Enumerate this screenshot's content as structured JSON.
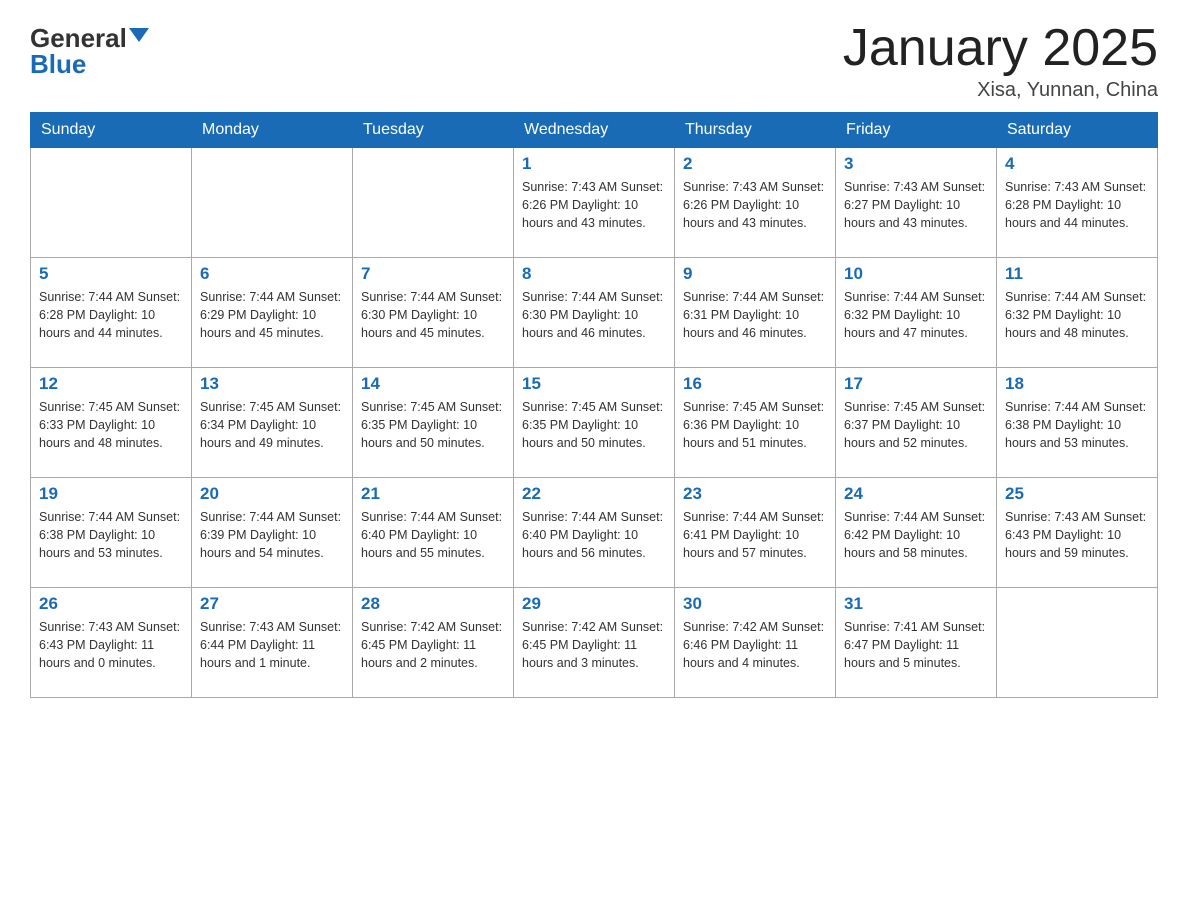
{
  "header": {
    "logo_text_black": "General",
    "logo_text_blue": "Blue",
    "month_title": "January 2025",
    "location": "Xisa, Yunnan, China"
  },
  "days_of_week": [
    "Sunday",
    "Monday",
    "Tuesday",
    "Wednesday",
    "Thursday",
    "Friday",
    "Saturday"
  ],
  "weeks": [
    [
      {
        "day": "",
        "info": ""
      },
      {
        "day": "",
        "info": ""
      },
      {
        "day": "",
        "info": ""
      },
      {
        "day": "1",
        "info": "Sunrise: 7:43 AM\nSunset: 6:26 PM\nDaylight: 10 hours\nand 43 minutes."
      },
      {
        "day": "2",
        "info": "Sunrise: 7:43 AM\nSunset: 6:26 PM\nDaylight: 10 hours\nand 43 minutes."
      },
      {
        "day": "3",
        "info": "Sunrise: 7:43 AM\nSunset: 6:27 PM\nDaylight: 10 hours\nand 43 minutes."
      },
      {
        "day": "4",
        "info": "Sunrise: 7:43 AM\nSunset: 6:28 PM\nDaylight: 10 hours\nand 44 minutes."
      }
    ],
    [
      {
        "day": "5",
        "info": "Sunrise: 7:44 AM\nSunset: 6:28 PM\nDaylight: 10 hours\nand 44 minutes."
      },
      {
        "day": "6",
        "info": "Sunrise: 7:44 AM\nSunset: 6:29 PM\nDaylight: 10 hours\nand 45 minutes."
      },
      {
        "day": "7",
        "info": "Sunrise: 7:44 AM\nSunset: 6:30 PM\nDaylight: 10 hours\nand 45 minutes."
      },
      {
        "day": "8",
        "info": "Sunrise: 7:44 AM\nSunset: 6:30 PM\nDaylight: 10 hours\nand 46 minutes."
      },
      {
        "day": "9",
        "info": "Sunrise: 7:44 AM\nSunset: 6:31 PM\nDaylight: 10 hours\nand 46 minutes."
      },
      {
        "day": "10",
        "info": "Sunrise: 7:44 AM\nSunset: 6:32 PM\nDaylight: 10 hours\nand 47 minutes."
      },
      {
        "day": "11",
        "info": "Sunrise: 7:44 AM\nSunset: 6:32 PM\nDaylight: 10 hours\nand 48 minutes."
      }
    ],
    [
      {
        "day": "12",
        "info": "Sunrise: 7:45 AM\nSunset: 6:33 PM\nDaylight: 10 hours\nand 48 minutes."
      },
      {
        "day": "13",
        "info": "Sunrise: 7:45 AM\nSunset: 6:34 PM\nDaylight: 10 hours\nand 49 minutes."
      },
      {
        "day": "14",
        "info": "Sunrise: 7:45 AM\nSunset: 6:35 PM\nDaylight: 10 hours\nand 50 minutes."
      },
      {
        "day": "15",
        "info": "Sunrise: 7:45 AM\nSunset: 6:35 PM\nDaylight: 10 hours\nand 50 minutes."
      },
      {
        "day": "16",
        "info": "Sunrise: 7:45 AM\nSunset: 6:36 PM\nDaylight: 10 hours\nand 51 minutes."
      },
      {
        "day": "17",
        "info": "Sunrise: 7:45 AM\nSunset: 6:37 PM\nDaylight: 10 hours\nand 52 minutes."
      },
      {
        "day": "18",
        "info": "Sunrise: 7:44 AM\nSunset: 6:38 PM\nDaylight: 10 hours\nand 53 minutes."
      }
    ],
    [
      {
        "day": "19",
        "info": "Sunrise: 7:44 AM\nSunset: 6:38 PM\nDaylight: 10 hours\nand 53 minutes."
      },
      {
        "day": "20",
        "info": "Sunrise: 7:44 AM\nSunset: 6:39 PM\nDaylight: 10 hours\nand 54 minutes."
      },
      {
        "day": "21",
        "info": "Sunrise: 7:44 AM\nSunset: 6:40 PM\nDaylight: 10 hours\nand 55 minutes."
      },
      {
        "day": "22",
        "info": "Sunrise: 7:44 AM\nSunset: 6:40 PM\nDaylight: 10 hours\nand 56 minutes."
      },
      {
        "day": "23",
        "info": "Sunrise: 7:44 AM\nSunset: 6:41 PM\nDaylight: 10 hours\nand 57 minutes."
      },
      {
        "day": "24",
        "info": "Sunrise: 7:44 AM\nSunset: 6:42 PM\nDaylight: 10 hours\nand 58 minutes."
      },
      {
        "day": "25",
        "info": "Sunrise: 7:43 AM\nSunset: 6:43 PM\nDaylight: 10 hours\nand 59 minutes."
      }
    ],
    [
      {
        "day": "26",
        "info": "Sunrise: 7:43 AM\nSunset: 6:43 PM\nDaylight: 11 hours\nand 0 minutes."
      },
      {
        "day": "27",
        "info": "Sunrise: 7:43 AM\nSunset: 6:44 PM\nDaylight: 11 hours\nand 1 minute."
      },
      {
        "day": "28",
        "info": "Sunrise: 7:42 AM\nSunset: 6:45 PM\nDaylight: 11 hours\nand 2 minutes."
      },
      {
        "day": "29",
        "info": "Sunrise: 7:42 AM\nSunset: 6:45 PM\nDaylight: 11 hours\nand 3 minutes."
      },
      {
        "day": "30",
        "info": "Sunrise: 7:42 AM\nSunset: 6:46 PM\nDaylight: 11 hours\nand 4 minutes."
      },
      {
        "day": "31",
        "info": "Sunrise: 7:41 AM\nSunset: 6:47 PM\nDaylight: 11 hours\nand 5 minutes."
      },
      {
        "day": "",
        "info": ""
      }
    ]
  ]
}
